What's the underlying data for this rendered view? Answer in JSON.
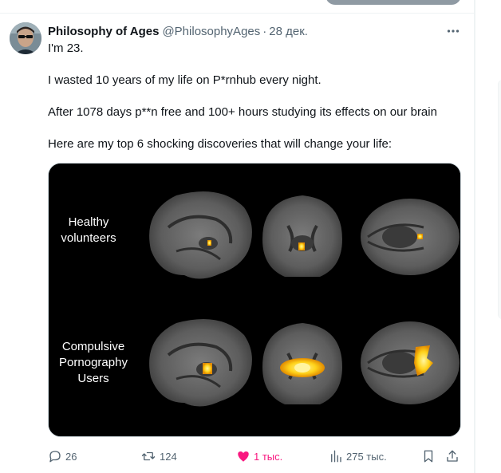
{
  "tweet": {
    "author": {
      "display_name": "Philosophy of Ages",
      "handle": "@PhilosophyAges"
    },
    "separator": "·",
    "date": "28 дек.",
    "text": [
      "I'm 23.",
      "I wasted 10 years of my life on P*rnhub every night.",
      "After 1078 days p**n free and 100+ hours studying its effects on our brain",
      "Here are my top 6 shocking discoveries that will change your life:"
    ],
    "media": {
      "row_labels": [
        [
          "Healthy",
          "volunteers"
        ],
        [
          "Compulsive",
          "Pornography",
          "Users"
        ]
      ]
    },
    "actions": {
      "replies": "26",
      "reposts": "124",
      "likes": "1 тыс.",
      "views": "275 тыс."
    }
  },
  "colors": {
    "text_primary": "#0f1419",
    "text_secondary": "#536471",
    "like_active": "#f91880",
    "border": "#cfd9de"
  },
  "icons": {
    "more": "more-horizontal-icon",
    "reply": "reply-icon",
    "repost": "repost-icon",
    "like": "heart-filled-icon",
    "views": "views-chart-icon",
    "bookmark": "bookmark-icon",
    "share": "share-icon"
  }
}
